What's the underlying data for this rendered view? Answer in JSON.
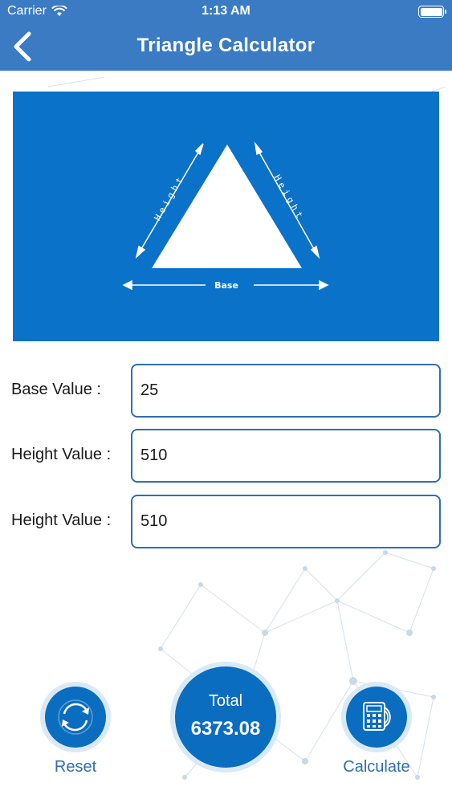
{
  "status_bar": {
    "carrier": "Carrier",
    "time": "1:13 AM"
  },
  "nav": {
    "title": "Triangle Calculator",
    "back_icon": "chevron-left-icon"
  },
  "diagram": {
    "base_label": "Base",
    "left_side_label": "Height",
    "right_side_label": "Height"
  },
  "form": {
    "rows": [
      {
        "label": "Base Value :",
        "value": "25"
      },
      {
        "label": "Height Value :",
        "value": "510"
      },
      {
        "label": "Height Value :",
        "value": "510"
      }
    ]
  },
  "actions": {
    "reset_label": "Reset",
    "reset_icon": "refresh-icon",
    "total_label": "Total",
    "total_value": "6373.08",
    "calculate_label": "Calculate",
    "calculate_icon": "calculator-icon"
  },
  "colors": {
    "primary": "#3a7bc4",
    "diagram_bg": "#0a72c8",
    "accent": "#2f6fb0"
  }
}
